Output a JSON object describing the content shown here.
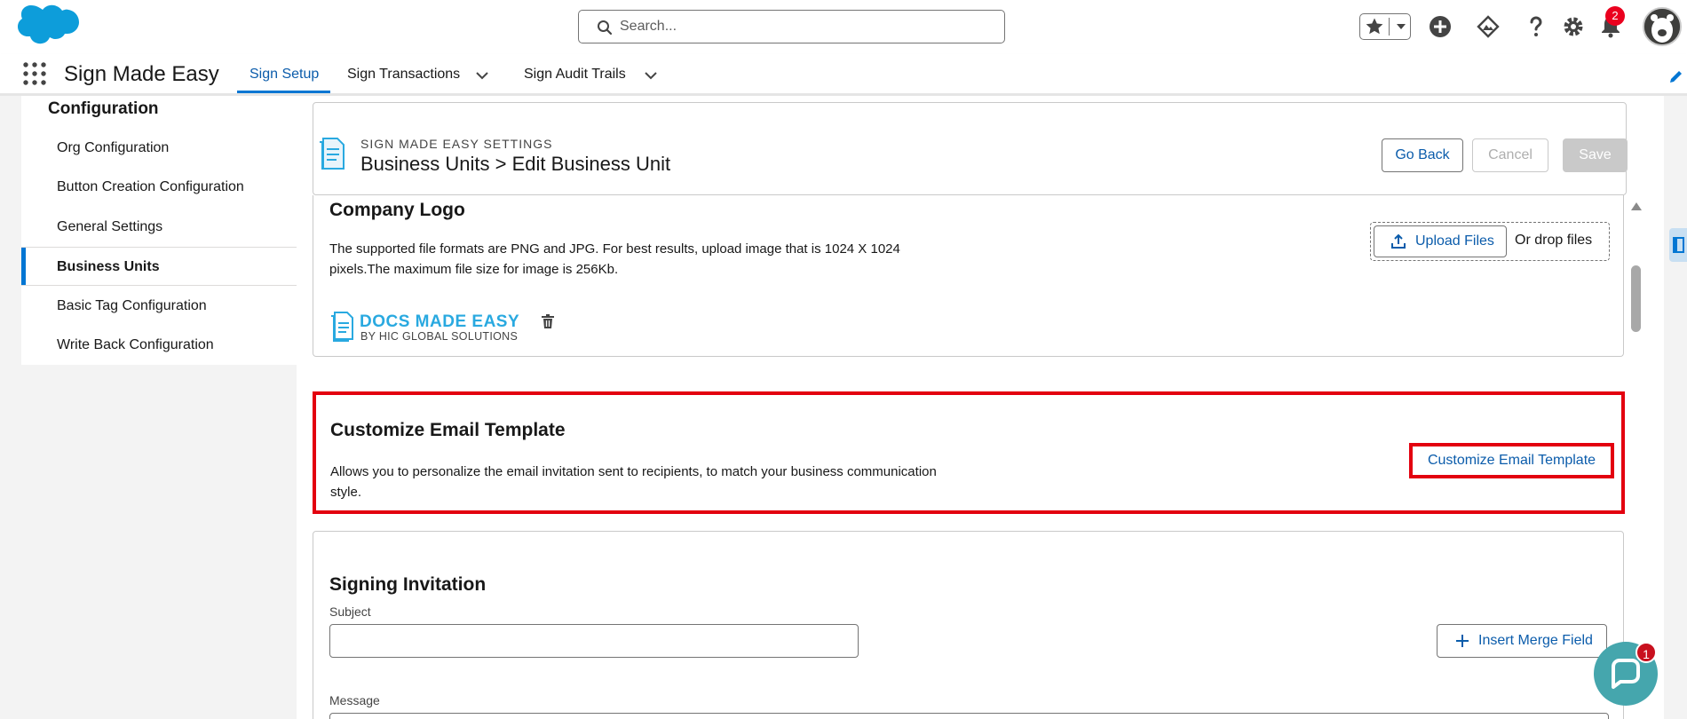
{
  "header": {
    "search_placeholder": "Search...",
    "notification_count": "2"
  },
  "nav": {
    "app_name": "Sign Made Easy",
    "tabs": [
      {
        "label": "Sign Setup",
        "active": true
      },
      {
        "label": "Sign Transactions",
        "has_menu": true
      },
      {
        "label": "Sign Audit Trails",
        "has_menu": true
      }
    ]
  },
  "sidebar": {
    "title": "Configuration",
    "items": [
      {
        "label": "Org Configuration"
      },
      {
        "label": "Button Creation Configuration"
      },
      {
        "label": "General Settings"
      },
      {
        "label": "Business Units",
        "active": true
      },
      {
        "label": "Basic Tag Configuration"
      },
      {
        "label": "Write Back Configuration"
      }
    ]
  },
  "page_header": {
    "eyebrow": "SIGN MADE EASY SETTINGS",
    "title": "Business Units > Edit Business Unit",
    "go_back": "Go Back",
    "cancel": "Cancel",
    "save": "Save"
  },
  "company_logo": {
    "title": "Company Logo",
    "description_line1": "The supported file formats are PNG and JPG. For best results, upload image that is 1024 X 1024",
    "description_line2": "pixels.The maximum file size for image is 256Kb.",
    "upload_button": "Upload Files",
    "drop_text": "Or drop files",
    "logo_text": "DOCS MADE EASY",
    "logo_subtext": "BY HIC GLOBAL SOLUTIONS"
  },
  "customize_email": {
    "title": "Customize Email Template",
    "description_line1": "Allows you to personalize the email invitation sent to recipients, to match your business communication",
    "description_line2": "style.",
    "button": "Customize Email Template"
  },
  "signing_invitation": {
    "title": "Signing Invitation",
    "subject_label": "Subject",
    "subject_value": "",
    "insert_merge_field": "Insert Merge Field",
    "message_label": "Message"
  },
  "chat": {
    "badge_count": "1"
  },
  "colors": {
    "brand_blue": "#0176d3",
    "link_blue": "#0b5cab",
    "highlight_red": "#e3000f"
  }
}
